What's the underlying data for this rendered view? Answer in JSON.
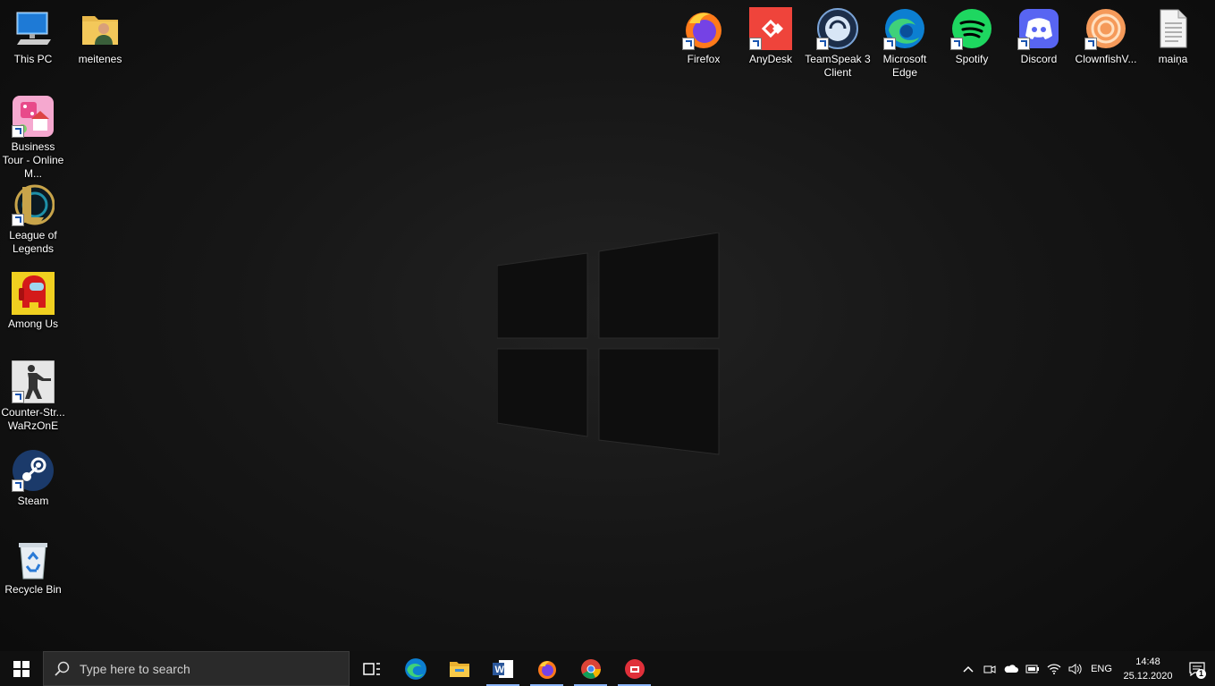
{
  "desktop": {
    "icons": [
      {
        "label": "This PC",
        "icon": "computer-icon"
      },
      {
        "label": "meitenes",
        "icon": "user-folder-icon"
      },
      {
        "label": "Business Tour - Online M...",
        "icon": "business-tour-icon"
      },
      {
        "label": "League of Legends",
        "icon": "league-of-legends-icon"
      },
      {
        "label": "Among Us",
        "icon": "among-us-icon"
      },
      {
        "label": "Counter-Str... WaRzOnE",
        "icon": "counter-strike-icon"
      },
      {
        "label": "Steam",
        "icon": "steam-icon"
      },
      {
        "label": "Recycle Bin",
        "icon": "recycle-bin-icon"
      },
      {
        "label": "Firefox",
        "icon": "firefox-icon"
      },
      {
        "label": "AnyDesk",
        "icon": "anydesk-icon"
      },
      {
        "label": "TeamSpeak 3 Client",
        "icon": "teamspeak-icon"
      },
      {
        "label": "Microsoft Edge",
        "icon": "edge-icon"
      },
      {
        "label": "Spotify",
        "icon": "spotify-icon"
      },
      {
        "label": "Discord",
        "icon": "discord-icon"
      },
      {
        "label": "ClownfishV...",
        "icon": "clownfish-icon"
      },
      {
        "label": "maiņa",
        "icon": "text-file-icon"
      }
    ]
  },
  "taskbar": {
    "search_placeholder": "Type here to search",
    "pinned": [
      "task-view-icon",
      "edge-icon",
      "file-explorer-icon",
      "word-icon",
      "firefox-icon",
      "chrome-icon",
      "ea-app-icon"
    ],
    "tray": {
      "language": "ENG",
      "time": "14:48",
      "date": "25.12.2020",
      "notification_count": "1"
    }
  },
  "colors": {
    "accent_blue": "#0078d7",
    "taskbar": "#101010"
  }
}
